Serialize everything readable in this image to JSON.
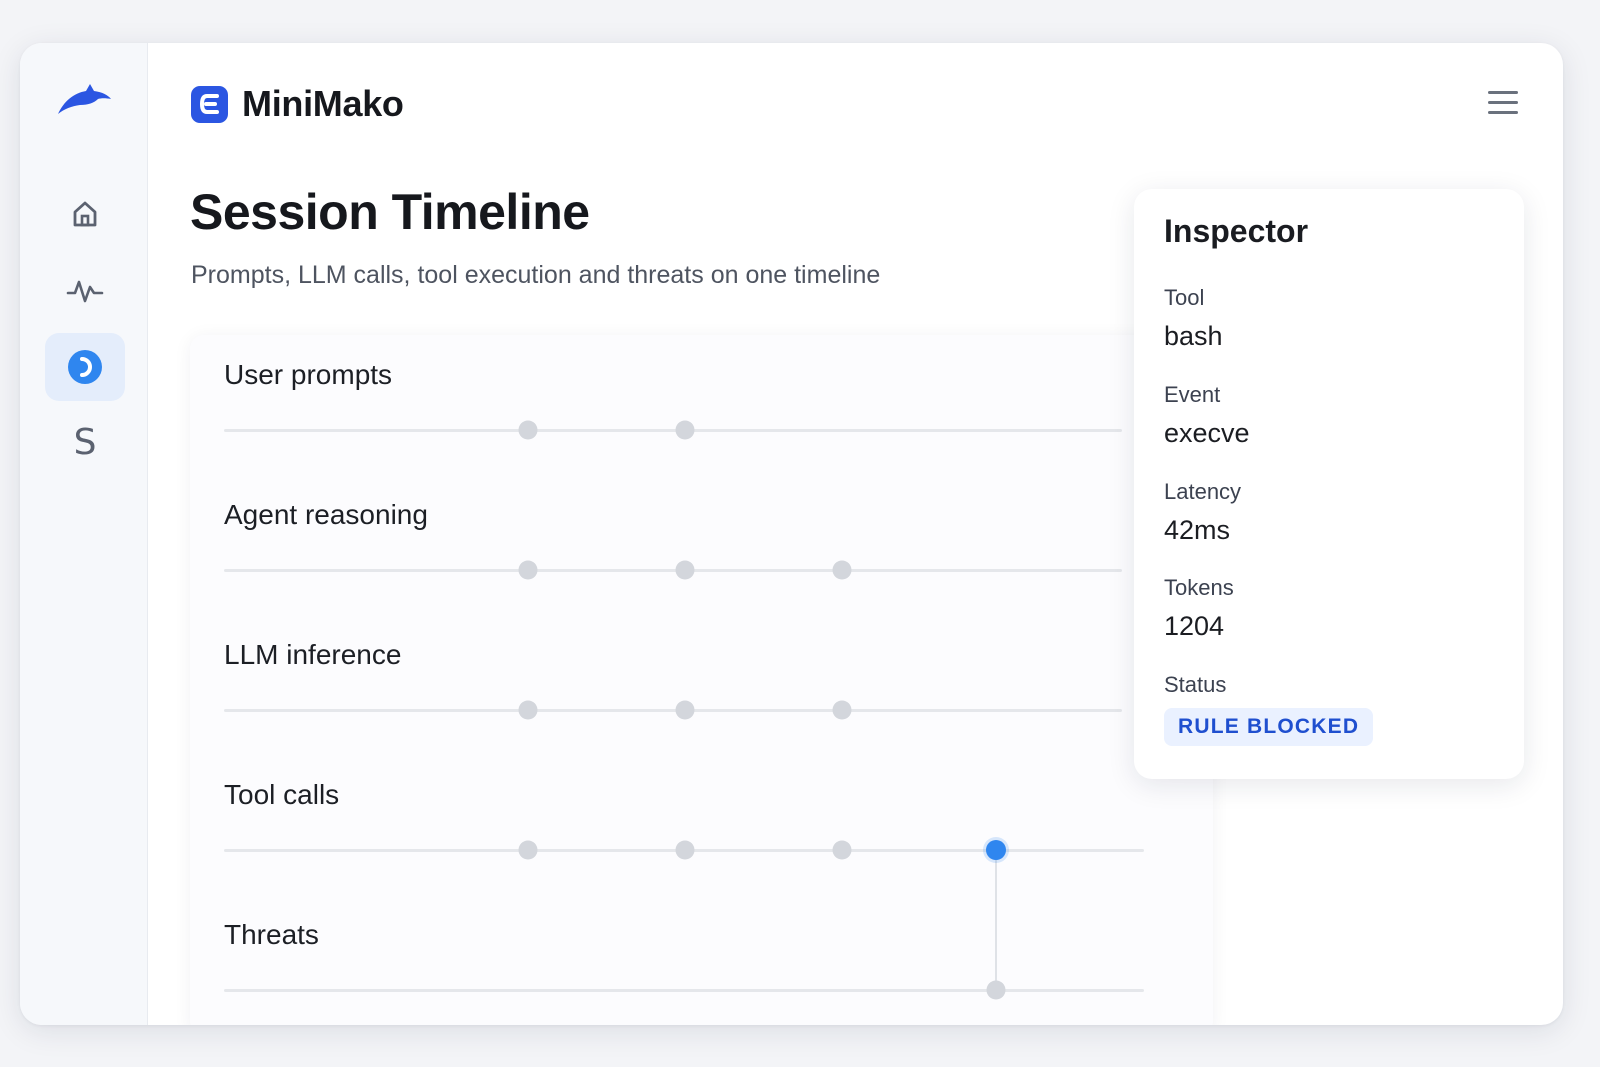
{
  "app": {
    "name": "MiniMako"
  },
  "sidebar": {
    "items": [
      {
        "icon": "home-icon"
      },
      {
        "icon": "activity-icon"
      },
      {
        "icon": "timeline-icon",
        "active": true
      },
      {
        "letter": "S"
      }
    ]
  },
  "page": {
    "title": "Session Timeline",
    "subtitle": "Prompts, LLM calls, tool execution and threats on one timeline"
  },
  "timeline": {
    "lanes": [
      {
        "label": "User prompts",
        "events": [
          1,
          2
        ]
      },
      {
        "label": "Agent reasoning",
        "events": [
          1,
          2,
          3
        ]
      },
      {
        "label": "LLM inference",
        "events": [
          1,
          2,
          3
        ]
      },
      {
        "label": "Tool calls",
        "events": [
          1,
          2,
          3,
          4
        ],
        "selected": 4
      },
      {
        "label": "Threats",
        "events": [
          4
        ]
      }
    ]
  },
  "inspector": {
    "title": "Inspector",
    "fields": [
      {
        "label": "Tool",
        "value": "bash"
      },
      {
        "label": "Event",
        "value": "execve"
      },
      {
        "label": "Latency",
        "value": "42ms"
      },
      {
        "label": "Tokens",
        "value": "1204"
      }
    ],
    "status_label": "Status",
    "status_value": "RULE BLOCKED"
  },
  "colors": {
    "accent": "#2f86ef",
    "brand": "#2b56e2",
    "badge_bg": "#eaf1ff",
    "badge_text": "#1f4fcf"
  }
}
